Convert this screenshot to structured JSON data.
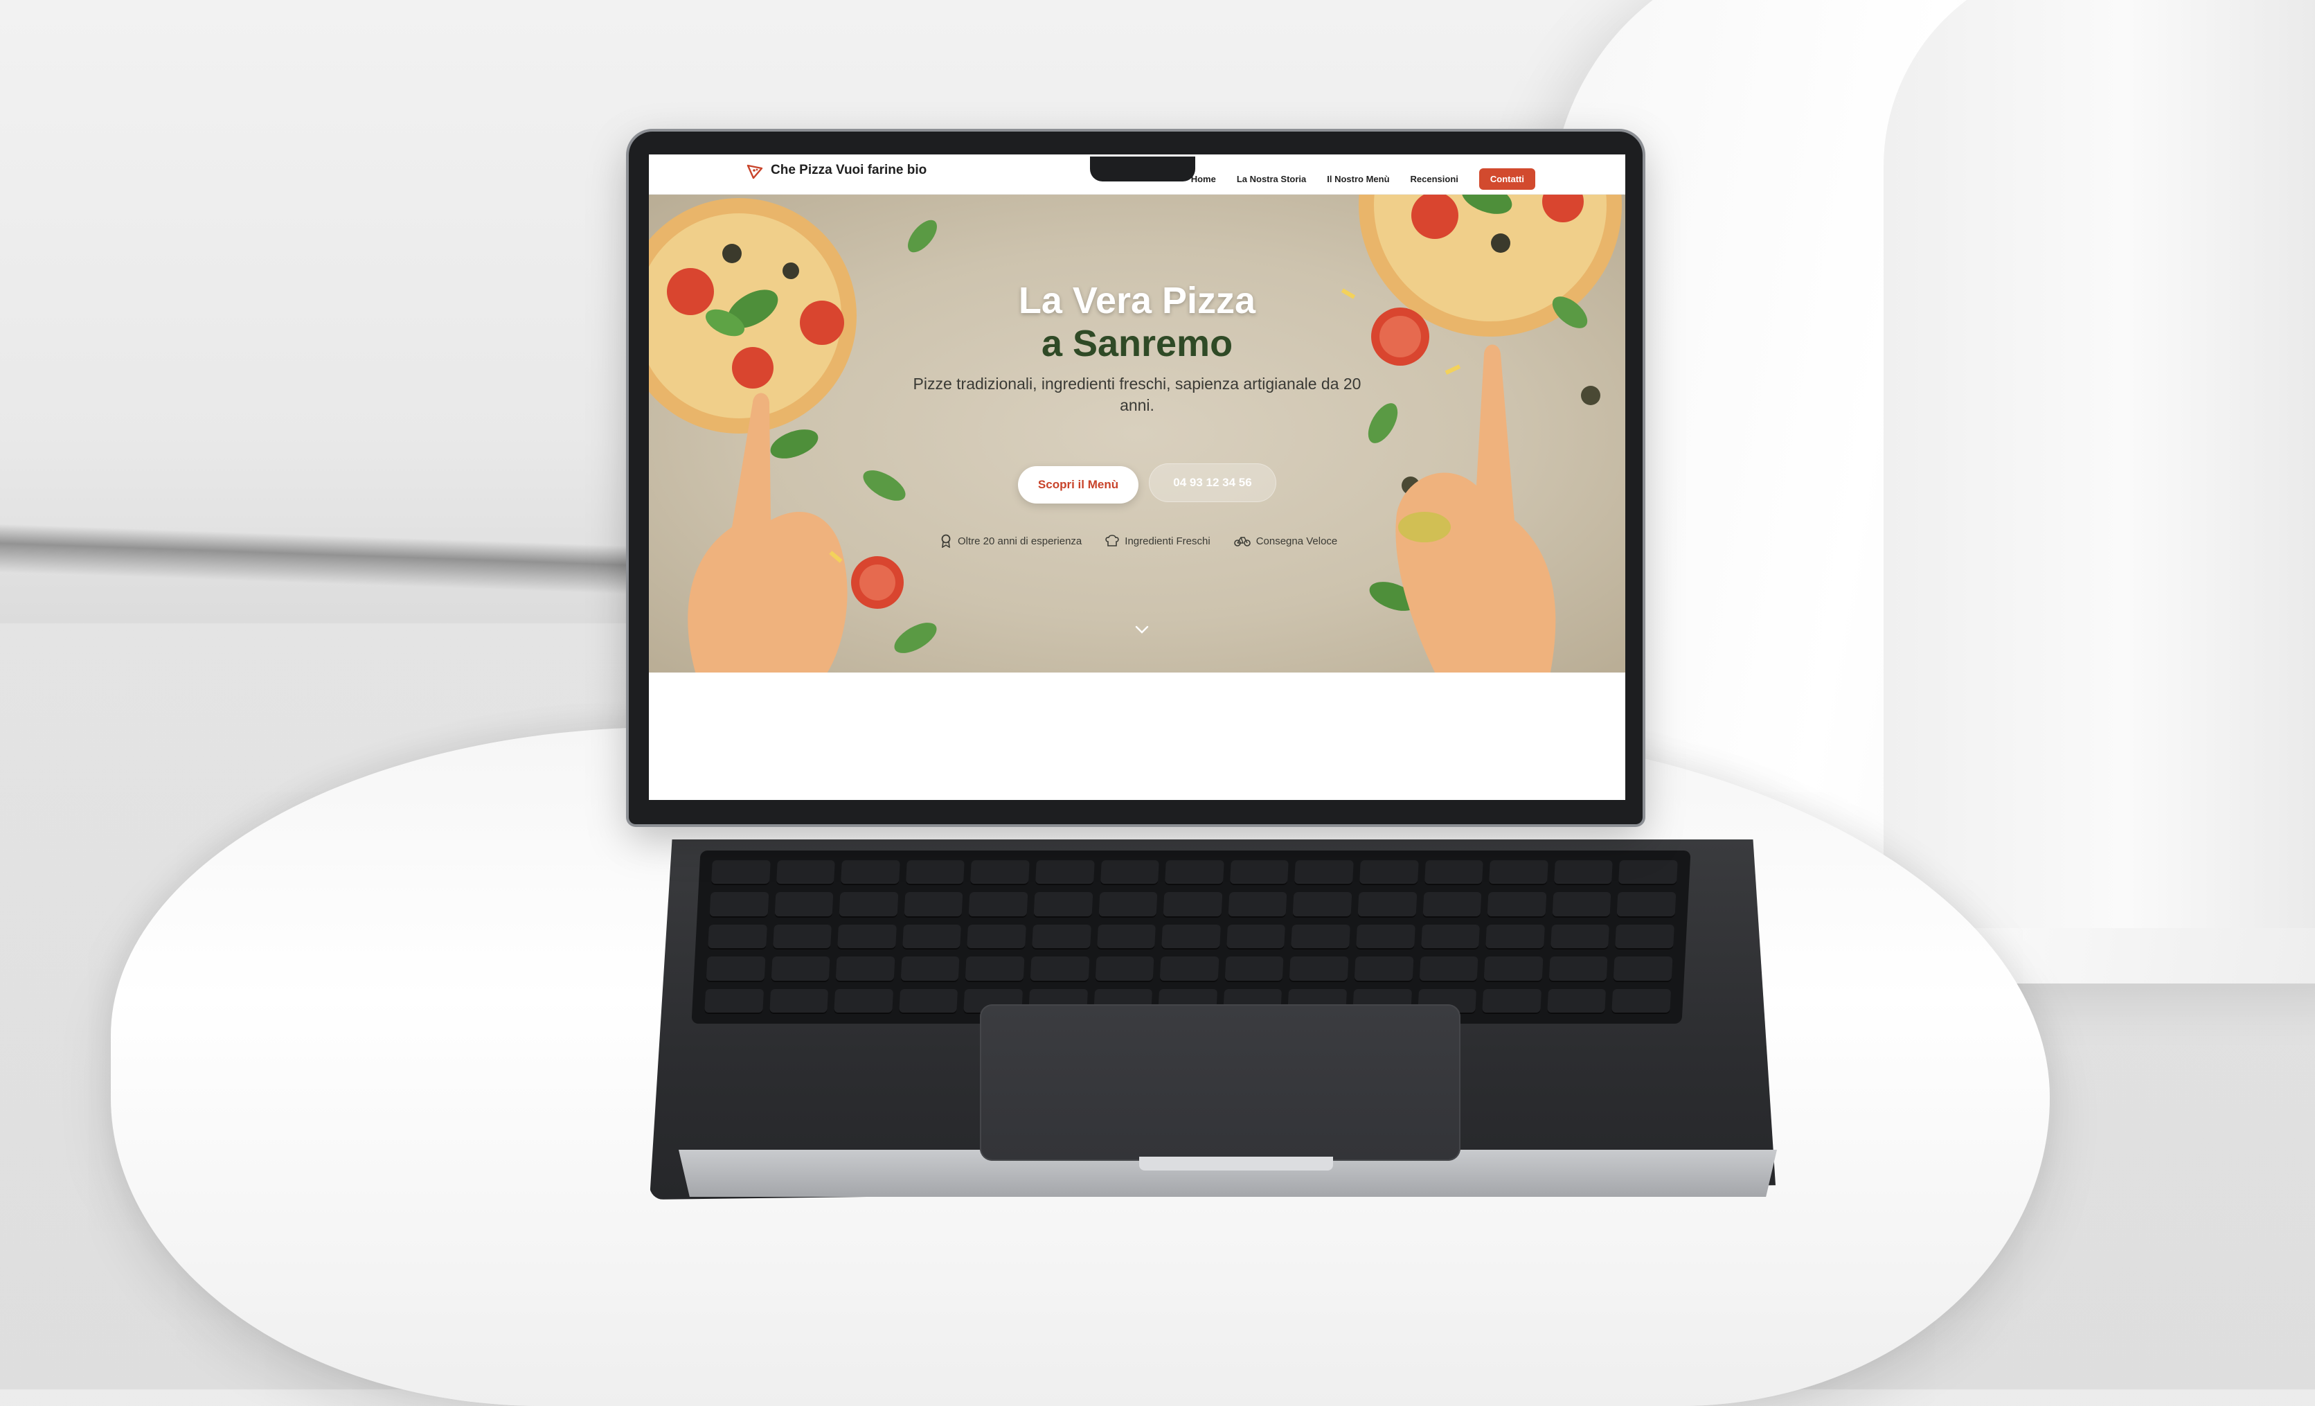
{
  "site": {
    "brand": "Che Pizza Vuoi farine bio",
    "nav": {
      "home": "Home",
      "story": "La Nostra Storia",
      "menu": "Il Nostro Menù",
      "reviews": "Recensioni",
      "contact": "Contatti"
    },
    "hero": {
      "title_line1": "La Vera Pizza",
      "title_line2": "a Sanremo",
      "subtitle": "Pizze tradizionali, ingredienti freschi, sapienza artigianale da 20 anni.",
      "primary_button": "Scopri il Menù",
      "secondary_button": "04 93 12 34 56",
      "features": [
        {
          "icon": "award-icon",
          "label": "Oltre 20 anni di esperienza"
        },
        {
          "icon": "chef-hat-icon",
          "label": "Ingredienti Freschi"
        },
        {
          "icon": "bicycle-icon",
          "label": "Consegna Veloce"
        }
      ]
    },
    "colors": {
      "accent": "#d24a2e",
      "title_green": "#2f4a26",
      "hero_bg": "#d2c8b4"
    }
  }
}
